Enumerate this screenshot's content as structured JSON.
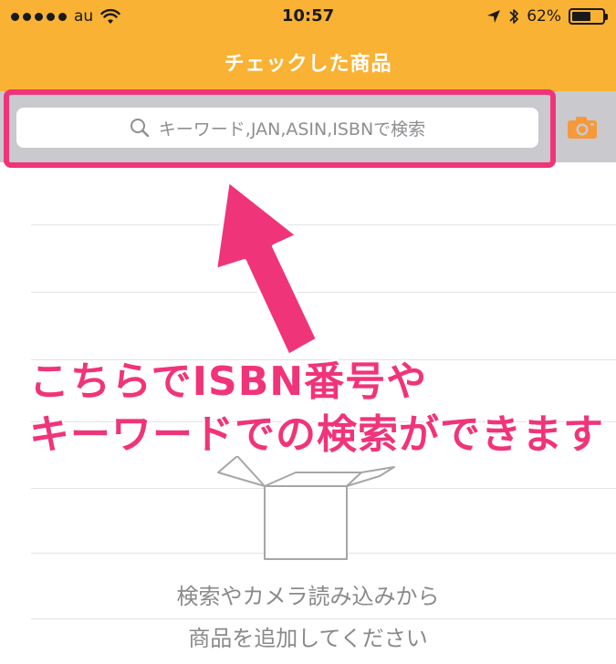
{
  "status_bar": {
    "carrier": "au",
    "time": "10:57",
    "battery_percent": "62%",
    "battery_level": 0.62
  },
  "nav": {
    "title": "チェックした商品"
  },
  "search": {
    "placeholder": "キーワード,JAN,ASIN,ISBNで検索"
  },
  "icons": {
    "search": "search-icon",
    "camera": "camera-icon",
    "wifi": "wifi-icon",
    "location": "location-arrow-icon",
    "bluetooth": "bluetooth-icon",
    "empty_box": "empty-box-icon"
  },
  "annotation": {
    "line1": "こちらでISBN番号や",
    "line2": "キーワードでの検索ができます"
  },
  "empty_state": {
    "line1": "検索やカメラ読み込みから",
    "line2": "商品を追加してください"
  },
  "colors": {
    "header": "#f9b233",
    "accent": "#f0347a",
    "camera": "#f59a3b"
  }
}
